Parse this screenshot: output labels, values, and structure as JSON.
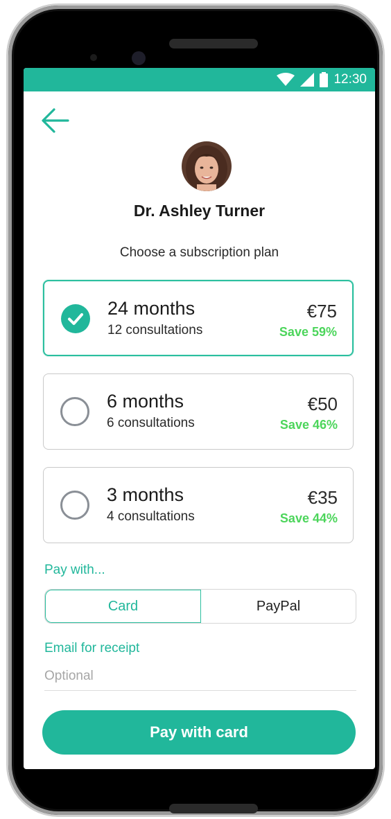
{
  "status_bar": {
    "time": "12:30",
    "icons": [
      "wifi-icon",
      "signal-icon",
      "battery-icon"
    ]
  },
  "header": {
    "back_icon": "arrow-left-icon",
    "doctor_name": "Dr. Ashley Turner"
  },
  "subtitle": "Choose a subscription plan",
  "plans": [
    {
      "duration": "24 months",
      "consultations": "12 consultations",
      "price": "€75",
      "save": "Save 59%",
      "selected": true
    },
    {
      "duration": "6 months",
      "consultations": "6 consultations",
      "price": "€50",
      "save": "Save 46%",
      "selected": false
    },
    {
      "duration": "3 months",
      "consultations": "4 consultations",
      "price": "€35",
      "save": "Save 44%",
      "selected": false
    }
  ],
  "payment": {
    "label": "Pay with...",
    "options": [
      "Card",
      "PayPal"
    ],
    "selected": "Card"
  },
  "email": {
    "label": "Email for receipt",
    "placeholder": "Optional",
    "value": ""
  },
  "cta": {
    "label": "Pay with card"
  },
  "colors": {
    "accent": "#21b79b",
    "save_green": "#4cd55b",
    "border": "#c9c9c9"
  }
}
